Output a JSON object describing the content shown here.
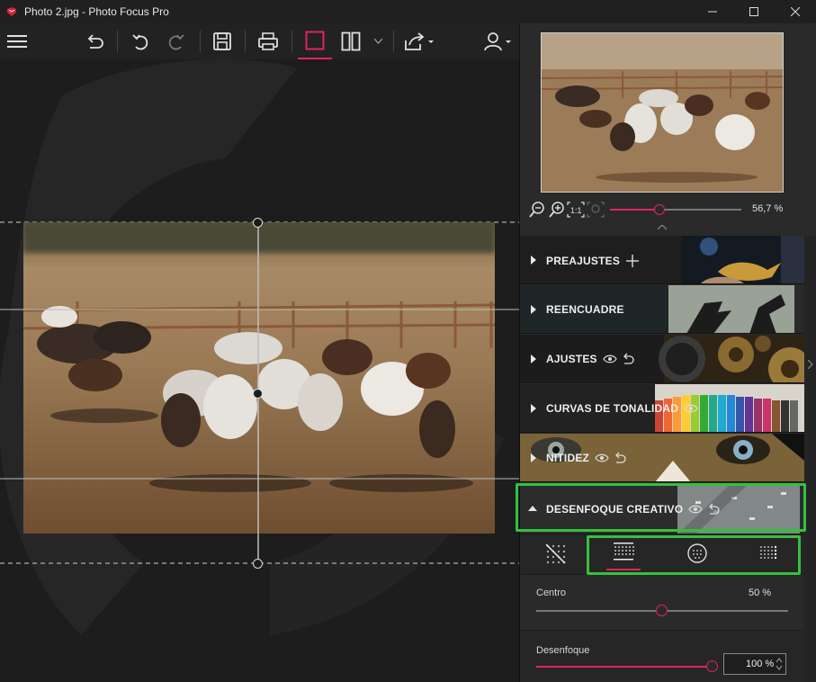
{
  "window": {
    "title": "Photo 2.jpg - Photo Focus Pro"
  },
  "toolbar": {
    "buttons": [
      "menu-icon",
      "revert-icon",
      "undo-icon",
      "redo-icon",
      "save-icon",
      "print-icon",
      "single-view-icon",
      "split-view-icon",
      "share-icon",
      "user-icon"
    ]
  },
  "navigator": {
    "zoom_value": "56,7 %",
    "zoom_fraction": 0.38
  },
  "panel": {
    "sections": [
      {
        "label": "PREAJUSTES",
        "extra": "plus"
      },
      {
        "label": "REENCUADRE",
        "extra": ""
      },
      {
        "label": "AJUSTES",
        "extra": "eye-reset"
      },
      {
        "label": "CURVAS DE TONALIDAD",
        "extra": "eye"
      },
      {
        "label": "NITIDEZ",
        "extra": "eye-reset"
      },
      {
        "label": "DESENFOQUE CREATIVO",
        "extra": "eye-reset",
        "expanded": true
      }
    ],
    "blur_tabs": [
      "no-blur-icon",
      "linear-blur-icon",
      "radial-blur-icon",
      "dot-blur-icon"
    ],
    "selected_blur_tab": 1,
    "params": {
      "center": {
        "label": "Centro",
        "value": "50 %",
        "fraction": 0.5
      },
      "blur": {
        "label": "Desenfoque",
        "value": "100 %",
        "fraction": 1.0
      }
    }
  },
  "colors": {
    "accent": "#e0245e",
    "highlight": "#35c13c",
    "panel_bg": "#2a2a2a"
  }
}
